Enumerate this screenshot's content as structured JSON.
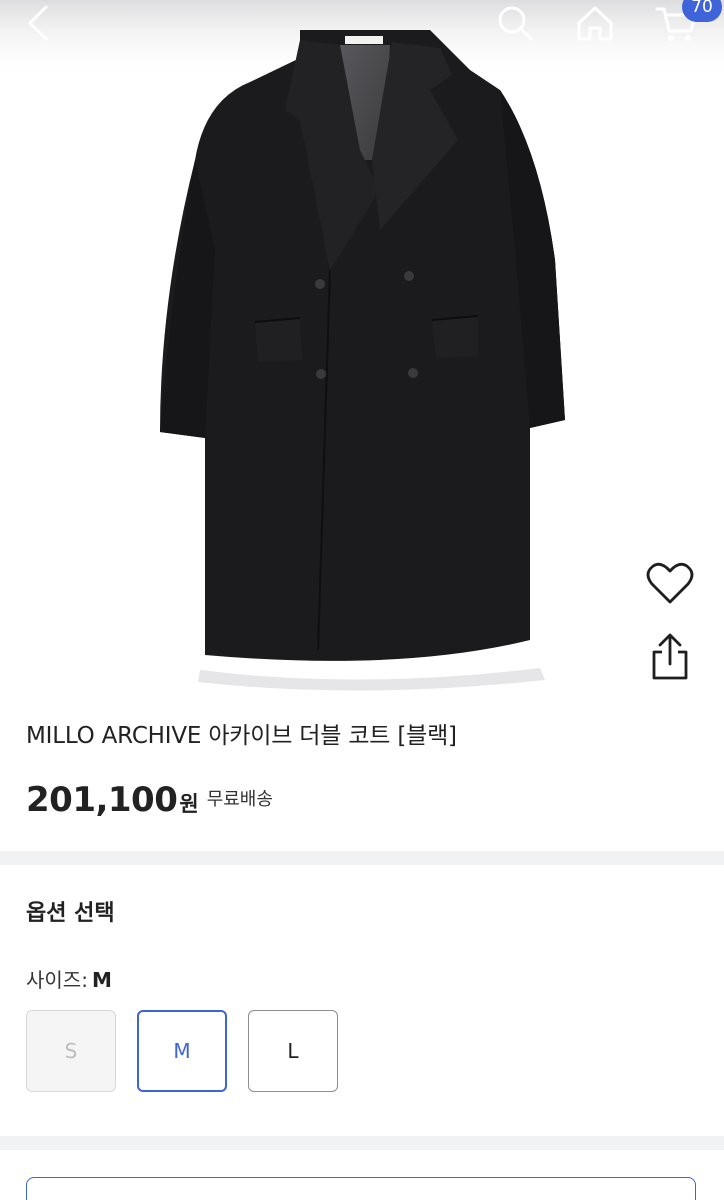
{
  "header": {
    "back_icon": "chevron-left-icon",
    "search_icon": "search-icon",
    "home_icon": "home-icon",
    "cart_icon": "cart-icon",
    "cart_badge": "70"
  },
  "product_image": {
    "label_text": "MILLO ARCHIVE"
  },
  "side_actions": {
    "like_icon": "heart-icon",
    "share_icon": "share-icon"
  },
  "product": {
    "title": "MILLO ARCHIVE 아카이브 더블 코트 [블랙]",
    "price": "201,100",
    "currency": "원",
    "shipping": "무료배송"
  },
  "options": {
    "heading": "옵션 선택",
    "size_label": "사이즈:",
    "selected_size": "M",
    "sizes": [
      {
        "label": "S",
        "state": "disabled"
      },
      {
        "label": "M",
        "state": "selected"
      },
      {
        "label": "L",
        "state": "available"
      }
    ]
  },
  "colors": {
    "accent": "#3f63d8",
    "divider": "#f1f2f4",
    "coat": "#1b1b1d"
  }
}
